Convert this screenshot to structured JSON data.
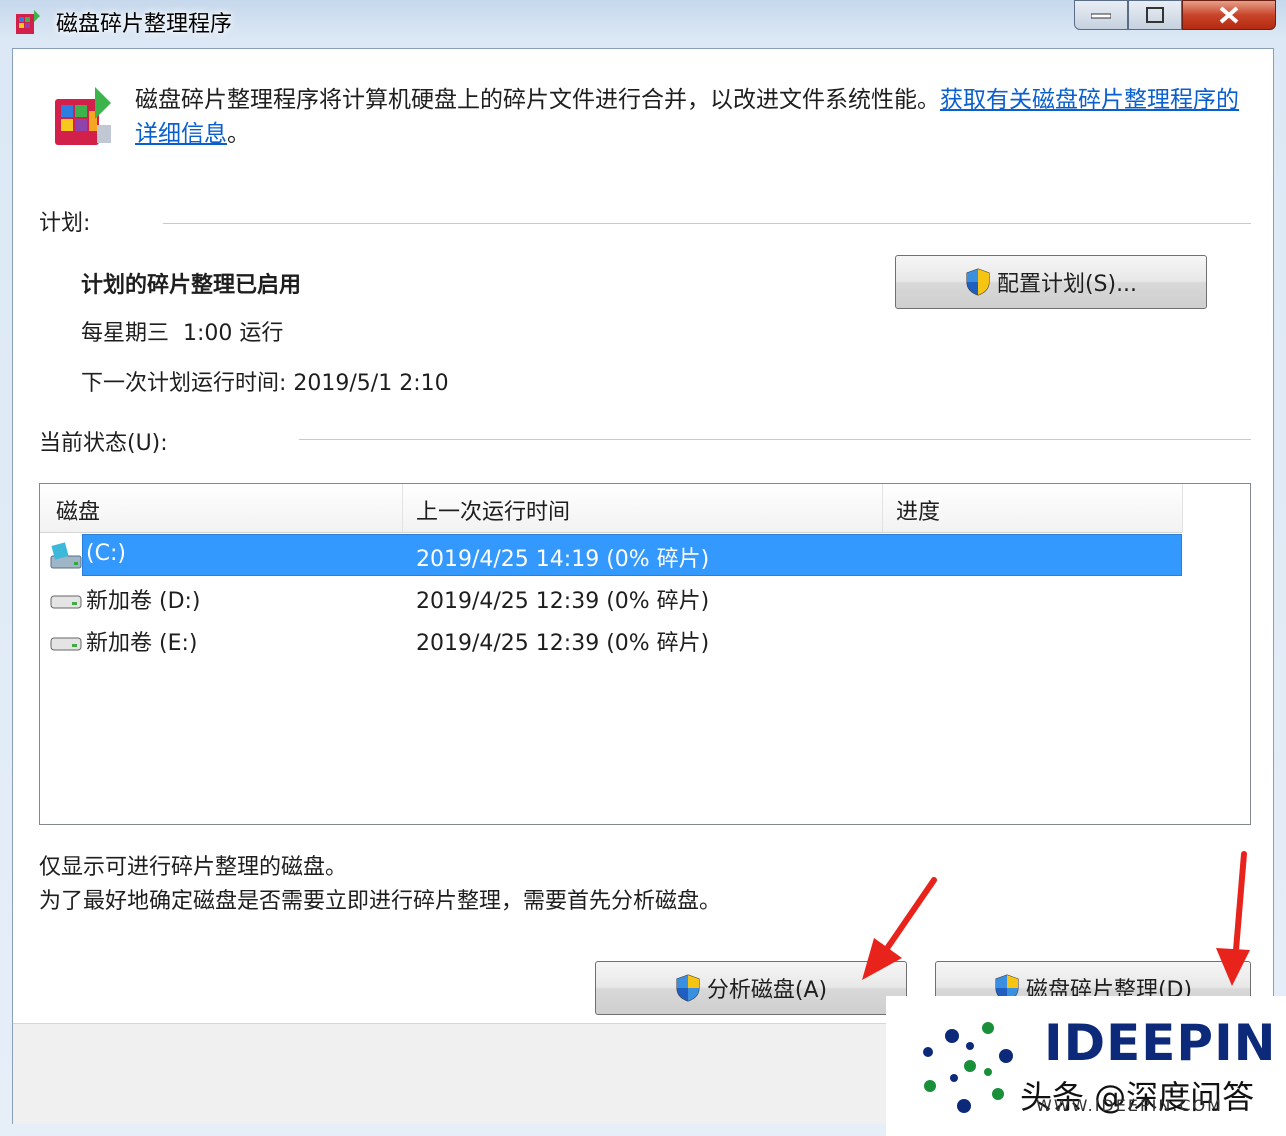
{
  "window": {
    "title": "磁盘碎片整理程序"
  },
  "intro": {
    "text": "磁盘碎片整理程序将计算机硬盘上的碎片文件进行合并，以改进文件系统性能。",
    "link": "获取有关磁盘碎片整理程序的详细信息",
    "suffix": "。"
  },
  "schedule": {
    "label": "计划:",
    "status": "计划的碎片整理已启用",
    "frequency": "每星期三  1:00 运行",
    "next_run": "下一次计划运行时间: 2019/5/1 2:10",
    "configure_button": "配置计划(S)..."
  },
  "current_status": {
    "label": "当前状态(U):",
    "columns": [
      "磁盘",
      "上一次运行时间",
      "进度"
    ],
    "disks": [
      {
        "name": "(C:)",
        "last_run": "2019/4/25 14:19 (0% 碎片)",
        "progress": "",
        "selected": true,
        "icon": "system-drive-icon"
      },
      {
        "name": "新加卷 (D:)",
        "last_run": "2019/4/25 12:39 (0% 碎片)",
        "progress": "",
        "selected": false,
        "icon": "drive-icon"
      },
      {
        "name": "新加卷 (E:)",
        "last_run": "2019/4/25 12:39 (0% 碎片)",
        "progress": "",
        "selected": false,
        "icon": "drive-icon"
      }
    ]
  },
  "notes": {
    "line1": "仅显示可进行碎片整理的磁盘。",
    "line2": "为了最好地确定磁盘是否需要立即进行碎片整理，需要首先分析磁盘。"
  },
  "buttons": {
    "analyze": "分析磁盘(A)",
    "defragment": "磁盘碎片整理(D)"
  },
  "watermark": {
    "brand": "IDEEPIN",
    "sub": "头条 @深度问答",
    "url": "WWW.IDEEPIN.COM"
  },
  "colors": {
    "selection": "#3399ff",
    "link": "#0a5fcf",
    "arrow": "#e8231c"
  }
}
